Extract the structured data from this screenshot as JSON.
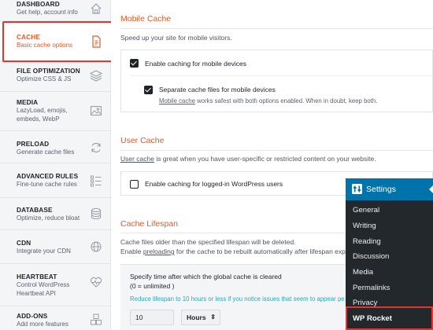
{
  "sidebar": {
    "items": [
      {
        "title": "DASHBOARD",
        "desc": "Get help, account info",
        "icon": "home-icon"
      },
      {
        "title": "CACHE",
        "desc": "Basic cache options",
        "icon": "document-icon"
      },
      {
        "title": "FILE OPTIMIZATION",
        "desc": "Optimize CSS & JS",
        "icon": "layers-icon"
      },
      {
        "title": "MEDIA",
        "desc": "LazyLoad, emojis, embeds, WebP",
        "icon": "image-icon"
      },
      {
        "title": "PRELOAD",
        "desc": "Generate cache files",
        "icon": "refresh-icon"
      },
      {
        "title": "ADVANCED RULES",
        "desc": "Fine-tune cache rules",
        "icon": "list-icon"
      },
      {
        "title": "DATABASE",
        "desc": "Optimize, reduce bloat",
        "icon": "database-icon"
      },
      {
        "title": "CDN",
        "desc": "Integrate your CDN",
        "icon": "globe-icon"
      },
      {
        "title": "HEARTBEAT",
        "desc": "Control WordPress Heartbeat API",
        "icon": "heartbeat-icon"
      },
      {
        "title": "ADD-ONS",
        "desc": "Add more features",
        "icon": "cubes-icon"
      }
    ]
  },
  "mobile_cache": {
    "title": "Mobile Cache",
    "description": "Speed up your site for mobile visitors.",
    "option1_label": "Enable caching for mobile devices",
    "option1_checked": true,
    "option2_label": "Separate cache files for mobile devices",
    "option2_checked": true,
    "note_link": "Mobile cache",
    "note_rest": " works safest with both options enabled. When in doubt, keep both."
  },
  "user_cache": {
    "title": "User Cache",
    "desc_link": "User cache",
    "desc_rest": " is great when you have user-specific or restricted content on your website.",
    "option_label": "Enable caching for logged-in WordPress users",
    "option_checked": false
  },
  "cache_lifespan": {
    "title": "Cache Lifespan",
    "line1": "Cache files older than the specified lifespan will be deleted.",
    "line2_pre": "Enable ",
    "line2_link": "preloading",
    "line2_rest": " for the cache to be rebuilt automatically after lifespan exp",
    "field_label": "Specify time after which the global cache is cleared",
    "field_sub": "(0 = unlimited )",
    "warning": "Reduce lifespan to 10 hours or less if you notice issues that seem to appear pe",
    "value": "10",
    "unit": "Hours"
  },
  "wp_menu": {
    "header": "Settings",
    "items": [
      "General",
      "Writing",
      "Reading",
      "Discussion",
      "Media",
      "Permalinks",
      "Privacy",
      "WP Rocket"
    ],
    "current": "WP Rocket"
  },
  "colors": {
    "accent": "#e05a2a",
    "highlight_outline": "#e3342f",
    "wp_admin_dark": "#23282d",
    "wp_admin_blue": "#0073aa",
    "warning_text": "#2aa7b8"
  }
}
